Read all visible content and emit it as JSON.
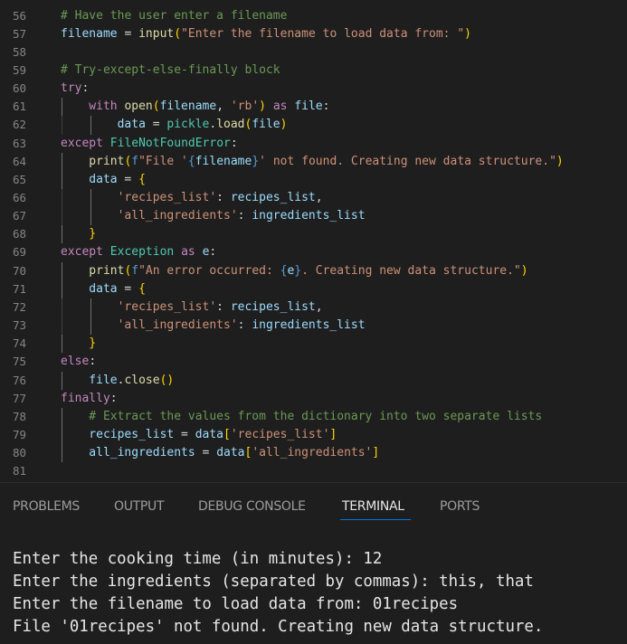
{
  "editor": {
    "lines": [
      {
        "num": "56",
        "indent": 0,
        "tokens": [
          [
            "com",
            "# Have the user enter a filename"
          ]
        ]
      },
      {
        "num": "57",
        "indent": 0,
        "tokens": [
          [
            "var",
            "filename"
          ],
          [
            "op",
            " = "
          ],
          [
            "fn",
            "input"
          ],
          [
            "b1",
            "("
          ],
          [
            "str",
            "\"Enter the filename to load data from: \""
          ],
          [
            "b1",
            ")"
          ]
        ]
      },
      {
        "num": "58",
        "indent": 0,
        "tokens": []
      },
      {
        "num": "59",
        "indent": 0,
        "tokens": [
          [
            "com",
            "# Try-except-else-finally block"
          ]
        ]
      },
      {
        "num": "60",
        "indent": 0,
        "tokens": [
          [
            "kw",
            "try"
          ],
          [
            "op",
            ":"
          ]
        ]
      },
      {
        "num": "61",
        "indent": 1,
        "tokens": [
          [
            "kw",
            "with "
          ],
          [
            "fn",
            "open"
          ],
          [
            "b1",
            "("
          ],
          [
            "var",
            "filename"
          ],
          [
            "op",
            ", "
          ],
          [
            "str",
            "'rb'"
          ],
          [
            "b1",
            ")"
          ],
          [
            "kw",
            " as "
          ],
          [
            "var",
            "file"
          ],
          [
            "op",
            ":"
          ]
        ]
      },
      {
        "num": "62",
        "indent": 2,
        "tokens": [
          [
            "var",
            "data"
          ],
          [
            "op",
            " = "
          ],
          [
            "cls",
            "pickle"
          ],
          [
            "op",
            "."
          ],
          [
            "fn",
            "load"
          ],
          [
            "b1",
            "("
          ],
          [
            "var",
            "file"
          ],
          [
            "b1",
            ")"
          ]
        ]
      },
      {
        "num": "63",
        "indent": 0,
        "tokens": [
          [
            "kw",
            "except "
          ],
          [
            "cls",
            "FileNotFoundError"
          ],
          [
            "op",
            ":"
          ]
        ]
      },
      {
        "num": "64",
        "indent": 1,
        "tokens": [
          [
            "fn",
            "print"
          ],
          [
            "b1",
            "("
          ],
          [
            "esc",
            "f"
          ],
          [
            "str",
            "\"File '"
          ],
          [
            "esc",
            "{"
          ],
          [
            "var",
            "filename"
          ],
          [
            "esc",
            "}"
          ],
          [
            "str",
            "' not found. Creating new data structure.\""
          ],
          [
            "b1",
            ")"
          ]
        ]
      },
      {
        "num": "65",
        "indent": 1,
        "tokens": [
          [
            "var",
            "data"
          ],
          [
            "op",
            " = "
          ],
          [
            "b1",
            "{"
          ]
        ]
      },
      {
        "num": "66",
        "indent": 2,
        "tokens": [
          [
            "str",
            "'recipes_list'"
          ],
          [
            "op",
            ": "
          ],
          [
            "var",
            "recipes_list"
          ],
          [
            "op",
            ","
          ]
        ]
      },
      {
        "num": "67",
        "indent": 2,
        "tokens": [
          [
            "str",
            "'all_ingredients'"
          ],
          [
            "op",
            ": "
          ],
          [
            "var",
            "ingredients_list"
          ]
        ]
      },
      {
        "num": "68",
        "indent": 1,
        "tokens": [
          [
            "b1",
            "}"
          ]
        ]
      },
      {
        "num": "69",
        "indent": 0,
        "tokens": [
          [
            "kw",
            "except "
          ],
          [
            "cls",
            "Exception"
          ],
          [
            "kw",
            " as "
          ],
          [
            "var",
            "e"
          ],
          [
            "op",
            ":"
          ]
        ]
      },
      {
        "num": "70",
        "indent": 1,
        "tokens": [
          [
            "fn",
            "print"
          ],
          [
            "b1",
            "("
          ],
          [
            "esc",
            "f"
          ],
          [
            "str",
            "\"An error occurred: "
          ],
          [
            "esc",
            "{"
          ],
          [
            "var",
            "e"
          ],
          [
            "esc",
            "}"
          ],
          [
            "str",
            ". Creating new data structure.\""
          ],
          [
            "b1",
            ")"
          ]
        ]
      },
      {
        "num": "71",
        "indent": 1,
        "tokens": [
          [
            "var",
            "data"
          ],
          [
            "op",
            " = "
          ],
          [
            "b1",
            "{"
          ]
        ]
      },
      {
        "num": "72",
        "indent": 2,
        "tokens": [
          [
            "str",
            "'recipes_list'"
          ],
          [
            "op",
            ": "
          ],
          [
            "var",
            "recipes_list"
          ],
          [
            "op",
            ","
          ]
        ]
      },
      {
        "num": "73",
        "indent": 2,
        "tokens": [
          [
            "str",
            "'all_ingredients'"
          ],
          [
            "op",
            ": "
          ],
          [
            "var",
            "ingredients_list"
          ]
        ]
      },
      {
        "num": "74",
        "indent": 1,
        "tokens": [
          [
            "b1",
            "}"
          ]
        ]
      },
      {
        "num": "75",
        "indent": 0,
        "tokens": [
          [
            "kw",
            "else"
          ],
          [
            "op",
            ":"
          ]
        ]
      },
      {
        "num": "76",
        "indent": 1,
        "tokens": [
          [
            "var",
            "file"
          ],
          [
            "op",
            "."
          ],
          [
            "fn",
            "close"
          ],
          [
            "b1",
            "()"
          ]
        ]
      },
      {
        "num": "77",
        "indent": 0,
        "tokens": [
          [
            "kw",
            "finally"
          ],
          [
            "op",
            ":"
          ]
        ]
      },
      {
        "num": "78",
        "indent": 1,
        "tokens": [
          [
            "com",
            "# Extract the values from the dictionary into two separate lists"
          ]
        ]
      },
      {
        "num": "79",
        "indent": 1,
        "tokens": [
          [
            "var",
            "recipes_list"
          ],
          [
            "op",
            " = "
          ],
          [
            "var",
            "data"
          ],
          [
            "b1",
            "["
          ],
          [
            "str",
            "'recipes_list'"
          ],
          [
            "b1",
            "]"
          ]
        ]
      },
      {
        "num": "80",
        "indent": 1,
        "tokens": [
          [
            "var",
            "all_ingredients"
          ],
          [
            "op",
            " = "
          ],
          [
            "var",
            "data"
          ],
          [
            "b1",
            "["
          ],
          [
            "str",
            "'all_ingredients'"
          ],
          [
            "b1",
            "]"
          ]
        ]
      },
      {
        "num": "81",
        "indent": 0,
        "tokens": []
      }
    ]
  },
  "panel": {
    "tabs": [
      {
        "id": "problems",
        "label": "PROBLEMS",
        "active": false
      },
      {
        "id": "output",
        "label": "OUTPUT",
        "active": false
      },
      {
        "id": "debug-console",
        "label": "DEBUG CONSOLE",
        "active": false
      },
      {
        "id": "terminal",
        "label": "TERMINAL",
        "active": true
      },
      {
        "id": "ports",
        "label": "PORTS",
        "active": false
      }
    ],
    "terminal_lines": [
      "Enter the cooking time (in minutes): 12",
      "Enter the ingredients (separated by commas): this, that",
      "Enter the filename to load data from: 01recipes",
      "File '01recipes' not found. Creating new data structure."
    ]
  },
  "colors": {
    "background": "#1e1e1e",
    "accent": "#0078d4",
    "keyword": "#c586c0",
    "function": "#dcdcaa",
    "variable": "#9cdcfe",
    "string": "#ce9178",
    "class": "#4ec9b0",
    "comment": "#6a9955"
  }
}
